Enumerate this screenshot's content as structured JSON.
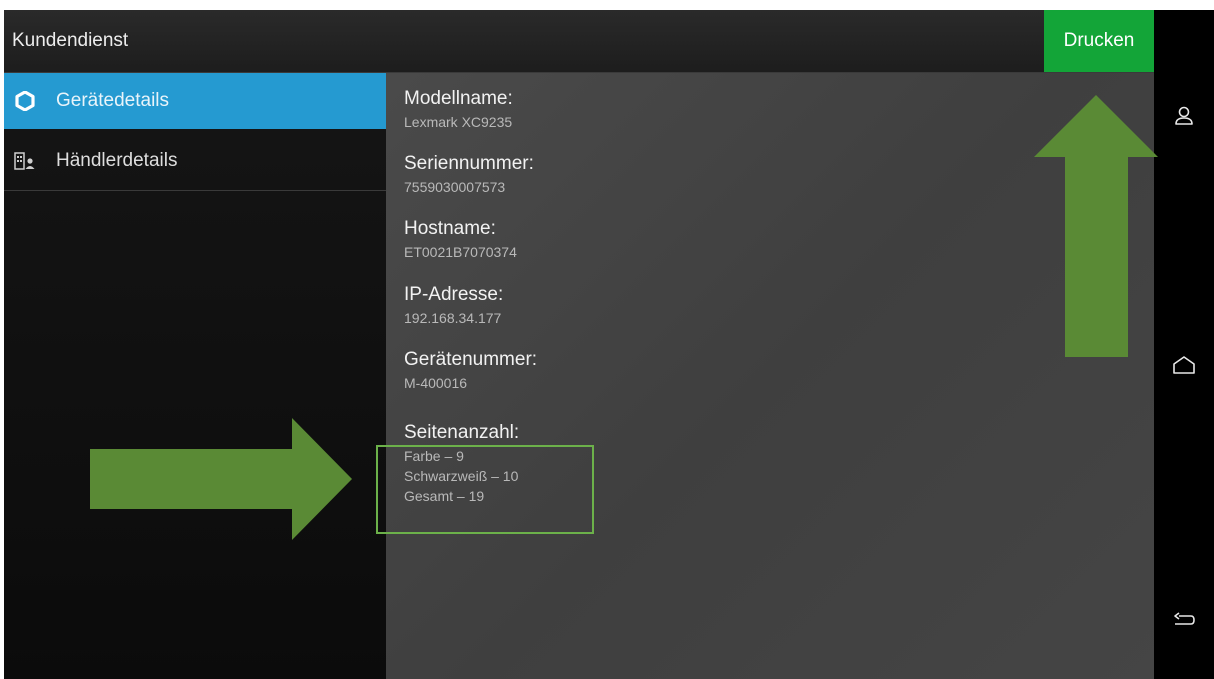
{
  "header": {
    "title": "Kundendienst",
    "print_label": "Drucken"
  },
  "sidebar": {
    "items": [
      {
        "label": "Gerätedetails",
        "icon": "hexagon-icon",
        "selected": true
      },
      {
        "label": "Händlerdetails",
        "icon": "dealer-icon",
        "selected": false
      }
    ]
  },
  "details": {
    "model": {
      "label": "Modellname:",
      "value": "Lexmark XC9235"
    },
    "serial": {
      "label": "Seriennummer:",
      "value": "7559030007573"
    },
    "hostname": {
      "label": "Hostname:",
      "value": "ET0021B7070374"
    },
    "ip": {
      "label": "IP-Adresse:",
      "value": "192.168.34.177"
    },
    "device_number": {
      "label": "Gerätenummer:",
      "value": "M-400016"
    },
    "page_count": {
      "label": "Seitenanzahl:",
      "lines": [
        "Farbe –  9",
        "Schwarzweiß –  10",
        "Gesamt – 19"
      ]
    }
  },
  "system_nav": {
    "icons": [
      "user-icon",
      "home-icon",
      "back-icon"
    ]
  },
  "colors": {
    "accent_blue": "#259ad1",
    "print_green": "#13a538",
    "annotation_green": "#5a8a35",
    "highlight_border": "#6cb14a"
  }
}
